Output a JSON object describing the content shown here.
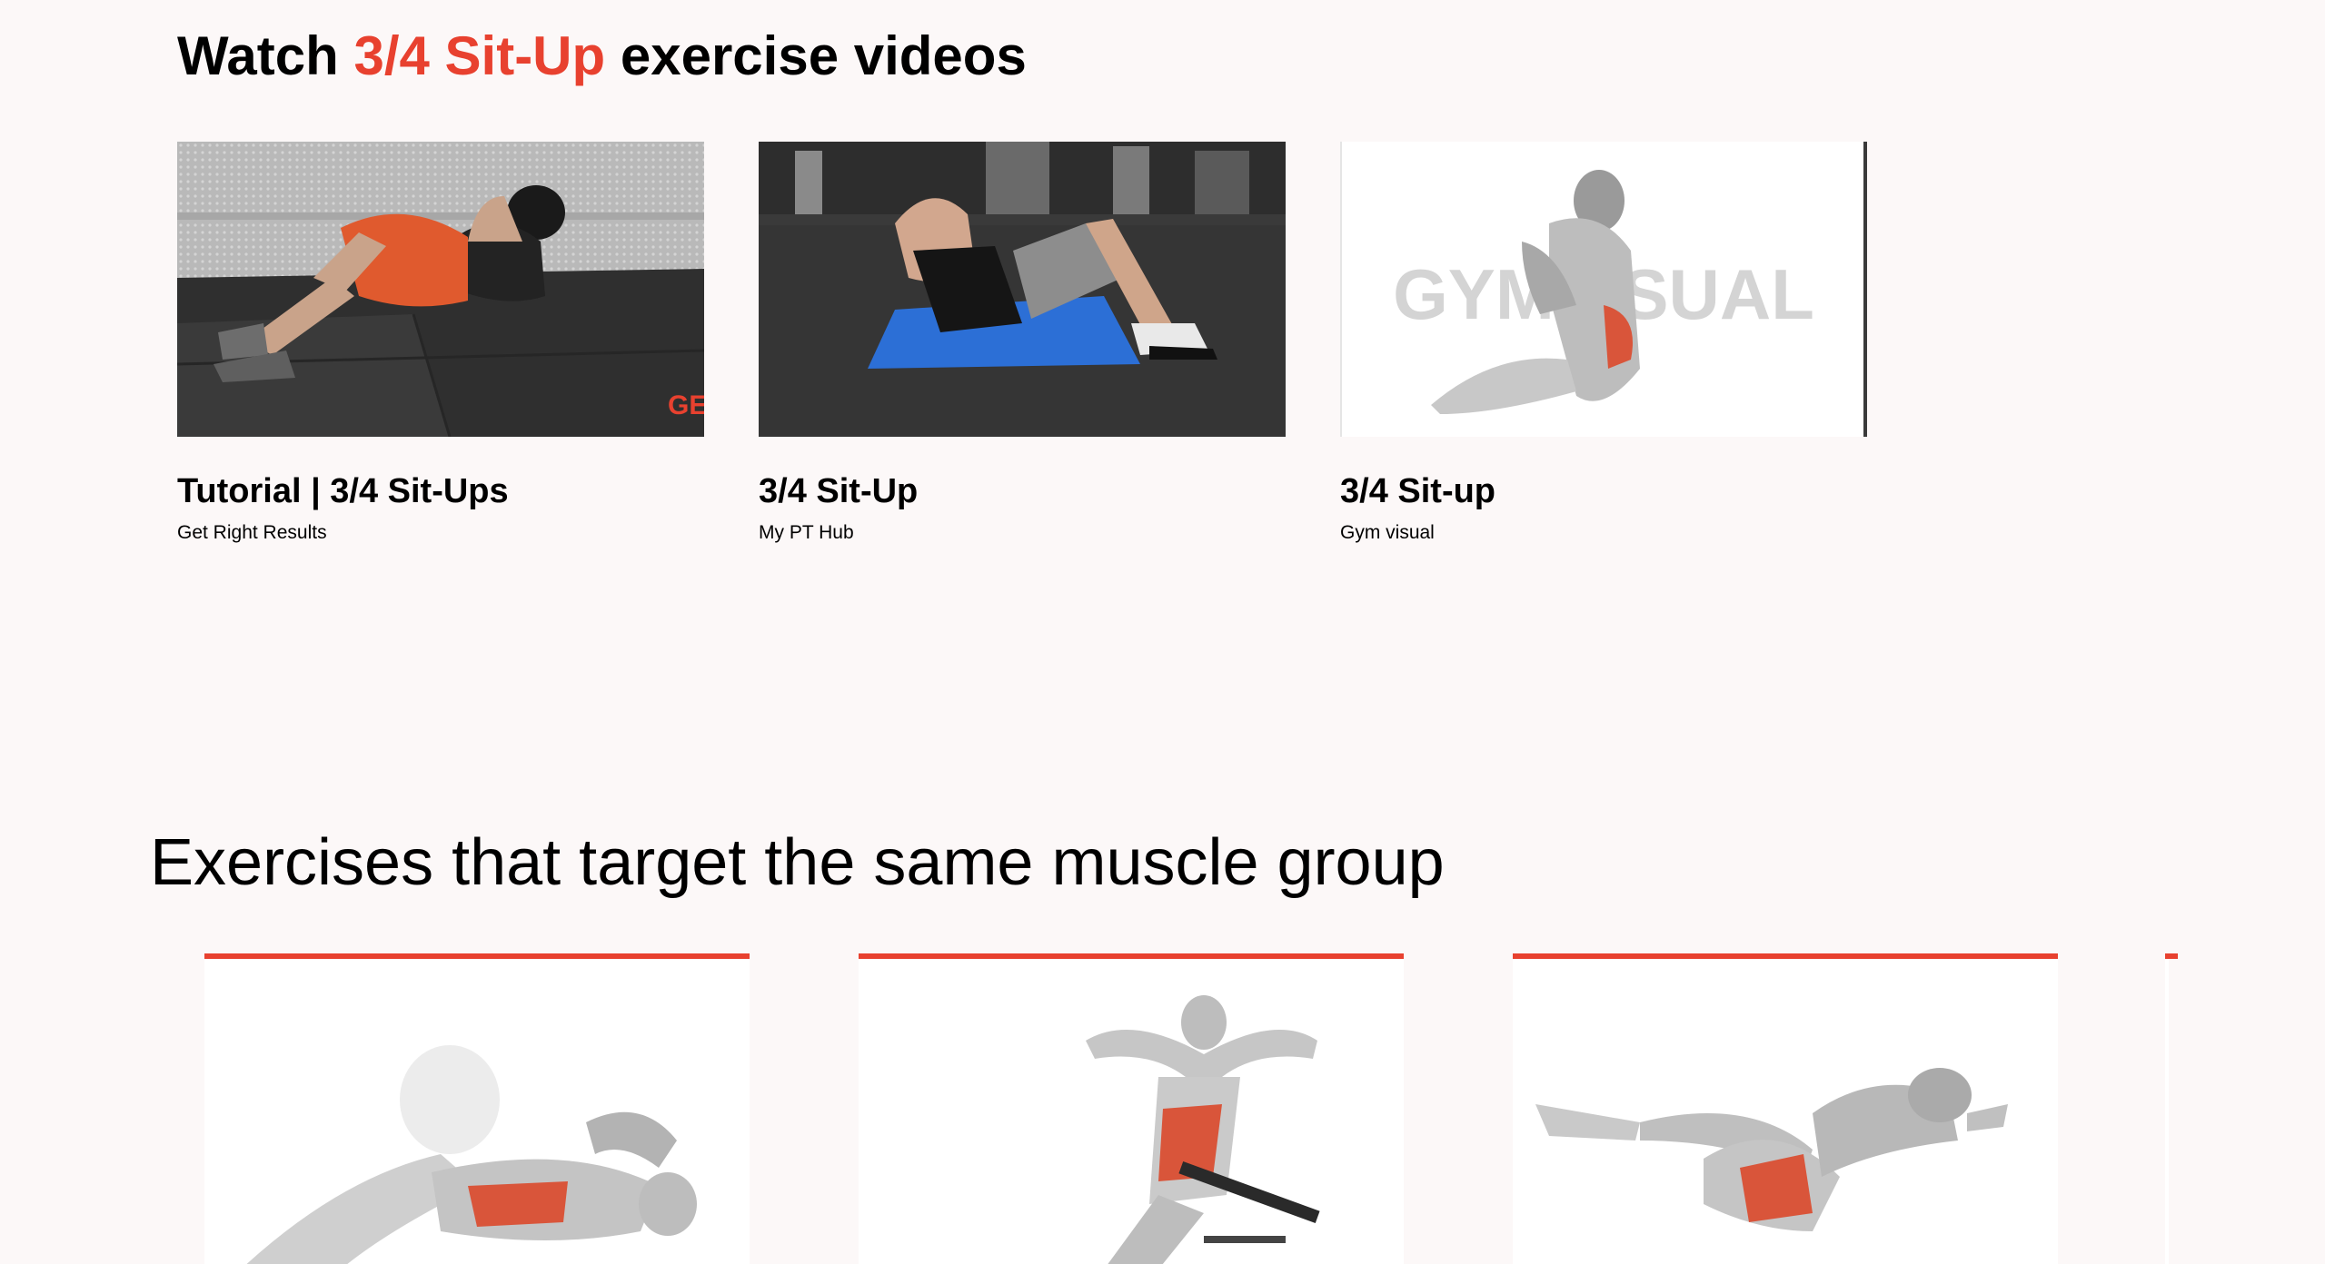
{
  "videos": {
    "heading_prefix": "Watch ",
    "heading_exercise": "3/4 Sit-Up",
    "heading_suffix": " exercise videos",
    "items": [
      {
        "title": "Tutorial | 3/4 Sit-Ups",
        "channel": "Get Right Results",
        "thumb_text": "GET R"
      },
      {
        "title": "3/4 Sit-Up",
        "channel": "My PT Hub"
      },
      {
        "title": "3/4 Sit-up",
        "channel": "Gym visual",
        "watermark": "GYMVISUAL"
      }
    ]
  },
  "related": {
    "heading": "Exercises that target the same muscle group",
    "cards": [
      {
        "icon": "crunch-figure-icon"
      },
      {
        "icon": "decline-situp-figure-icon"
      },
      {
        "icon": "bicycle-crunch-figure-icon"
      }
    ]
  },
  "colors": {
    "accent": "#e8412f",
    "background": "#fcf8f8"
  }
}
